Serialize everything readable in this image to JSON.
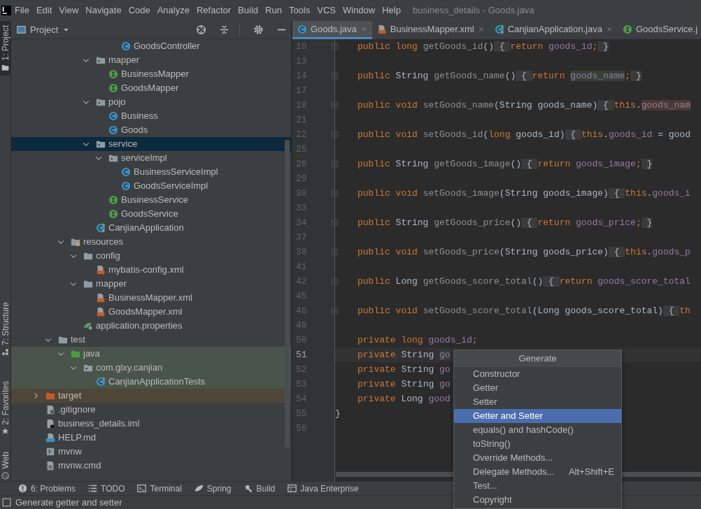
{
  "menu": {
    "items": [
      "File",
      "Edit",
      "View",
      "Navigate",
      "Code",
      "Analyze",
      "Refactor",
      "Build",
      "Run",
      "Tools",
      "VCS",
      "Window",
      "Help"
    ],
    "title": "business_details - Goods.java"
  },
  "tool_stripe": [
    {
      "label": "1: Project",
      "kind": "folder",
      "selected": true
    },
    {
      "label": "7: Structure",
      "kind": "structure",
      "selected": false
    },
    {
      "label": "2: Favorites",
      "kind": "star",
      "selected": false
    },
    {
      "label": "Web",
      "kind": "globe",
      "selected": false
    }
  ],
  "project_panel": {
    "title": "Project",
    "tree": [
      {
        "children": [
          {
            "children": [
              {
                "children": [
                  {
                    "children": [
                      {
                        "children": [
                          {
                            "children": [
                              {
                                "label": "GoodsController",
                                "kind": "class",
                                "selected": false
                              }
                            ]
                          }
                        ]
                      },
                      {
                        "label": "mapper",
                        "kind": "package",
                        "expanded": true,
                        "selected": false,
                        "children": [
                          {
                            "label": "BusinessMapper",
                            "kind": "interface",
                            "selected": false
                          },
                          {
                            "label": "GoodsMapper",
                            "kind": "interface",
                            "selected": false
                          }
                        ]
                      },
                      {
                        "label": "pojo",
                        "kind": "package",
                        "expanded": true,
                        "selected": false,
                        "children": [
                          {
                            "label": "Business",
                            "kind": "class",
                            "selected": false
                          },
                          {
                            "label": "Goods",
                            "kind": "class",
                            "selected": false
                          }
                        ]
                      },
                      {
                        "label": "service",
                        "kind": "package",
                        "expanded": true,
                        "selected": true,
                        "children": [
                          {
                            "label": "serviceImpl",
                            "kind": "package",
                            "expanded": true,
                            "selected": false,
                            "children": [
                              {
                                "label": "BusinessServiceImpl",
                                "kind": "class",
                                "selected": false
                              },
                              {
                                "label": "GoodsServiceImpl",
                                "kind": "class",
                                "selected": false
                              }
                            ]
                          },
                          {
                            "label": "BusinessService",
                            "kind": "interface",
                            "selected": false
                          },
                          {
                            "label": "GoodsService",
                            "kind": "interface",
                            "selected": false
                          }
                        ]
                      },
                      {
                        "label": "CanjianApplication",
                        "kind": "app",
                        "selected": false
                      }
                    ]
                  }
                ]
              },
              {
                "label": "resources",
                "kind": "resources",
                "expanded": true,
                "selected": false,
                "children": [
                  {
                    "label": "config",
                    "kind": "folder",
                    "expanded": true,
                    "selected": false,
                    "children": [
                      {
                        "label": "mybatis-config.xml",
                        "kind": "xml",
                        "selected": false
                      }
                    ]
                  },
                  {
                    "label": "mapper",
                    "kind": "folder",
                    "expanded": true,
                    "selected": false,
                    "children": [
                      {
                        "label": "BusinessMapper.xml",
                        "kind": "xml",
                        "selected": false
                      },
                      {
                        "label": "GoodsMapper.xml",
                        "kind": "xml",
                        "selected": false
                      }
                    ]
                  },
                  {
                    "label": "application.properties",
                    "kind": "properties",
                    "selected": false
                  }
                ]
              }
            ]
          },
          {
            "label": "test",
            "kind": "folder",
            "expanded": true,
            "selected": false,
            "children": [
              {
                "label": "java",
                "kind": "test-root",
                "expanded": true,
                "selected": false,
                "children": [
                  {
                    "label": "com.glxy.canjian",
                    "kind": "package",
                    "expanded": true,
                    "selected": false,
                    "children": [
                      {
                        "label": "CanjianApplicationTests",
                        "kind": "test-class",
                        "selected": false
                      }
                    ]
                  }
                ]
              }
            ]
          }
        ]
      },
      {
        "label": "target",
        "kind": "excluded",
        "expanded": false,
        "selected": false
      },
      {
        "label": ".gitignore",
        "kind": "gitignore",
        "selected": false
      },
      {
        "label": "business_details.iml",
        "kind": "iml",
        "selected": false
      },
      {
        "label": "HELP.md",
        "kind": "md",
        "selected": false
      },
      {
        "label": "mvnw",
        "kind": "shell",
        "selected": false
      },
      {
        "label": "mvnw.cmd",
        "kind": "cmd",
        "selected": false
      }
    ]
  },
  "editor": {
    "tabs": [
      {
        "label": "Goods.java",
        "kind": "class",
        "selected": true,
        "closable": true
      },
      {
        "label": "BusinessMapper.xml",
        "kind": "xml",
        "selected": false,
        "closable": true
      },
      {
        "label": "CanjianApplication.java",
        "kind": "app",
        "selected": false,
        "closable": true
      },
      {
        "label": "GoodsService.j",
        "kind": "interface",
        "selected": false,
        "closable": false
      }
    ],
    "lines": [
      {
        "number": "10",
        "folded": true,
        "current": false,
        "indented": true,
        "tokens": [
          {
            "text": "public long ",
            "kind": "keyword"
          },
          {
            "text": "getGoods_id",
            "kind": "method"
          },
          {
            "text": "()",
            "kind": "plain"
          },
          {
            "text": " { ",
            "kind": "fold"
          },
          {
            "text": "return ",
            "kind": "keyword"
          },
          {
            "text": "goods_id",
            "kind": "field"
          },
          {
            "text": ";",
            "kind": "keyword"
          },
          {
            "text": " }",
            "kind": "fold"
          }
        ]
      },
      {
        "number": "13",
        "folded": false,
        "current": false
      },
      {
        "number": "14",
        "folded": true,
        "current": false,
        "indented": true,
        "tokens": [
          {
            "text": "public ",
            "kind": "keyword"
          },
          {
            "text": "String ",
            "kind": "plain"
          },
          {
            "text": "getGoods_name",
            "kind": "method"
          },
          {
            "text": "()",
            "kind": "plain"
          },
          {
            "text": " { ",
            "kind": "fold"
          },
          {
            "text": "return ",
            "kind": "keyword"
          },
          {
            "text": "goods_name",
            "kind": "field-match"
          },
          {
            "text": ";",
            "kind": "keyword"
          },
          {
            "text": " }",
            "kind": "fold"
          }
        ]
      },
      {
        "number": "17",
        "folded": false,
        "current": false
      },
      {
        "number": "18",
        "folded": true,
        "current": false,
        "indented": true,
        "tokens": [
          {
            "text": "public void ",
            "kind": "keyword"
          },
          {
            "text": "setGoods_name",
            "kind": "method"
          },
          {
            "text": "(String goods_name)",
            "kind": "plain"
          },
          {
            "text": " { ",
            "kind": "fold"
          },
          {
            "text": "this",
            "kind": "keyword"
          },
          {
            "text": ".",
            "kind": "plain"
          },
          {
            "text": "goods_nam",
            "kind": "field-write"
          }
        ]
      },
      {
        "number": "21",
        "folded": false,
        "current": false
      },
      {
        "number": "22",
        "folded": true,
        "current": false,
        "indented": true,
        "tokens": [
          {
            "text": "public void ",
            "kind": "keyword"
          },
          {
            "text": "setGoods_id",
            "kind": "method"
          },
          {
            "text": "(",
            "kind": "plain"
          },
          {
            "text": "long",
            "kind": "keyword"
          },
          {
            "text": " goods_id)",
            "kind": "plain"
          },
          {
            "text": " { ",
            "kind": "fold"
          },
          {
            "text": "this",
            "kind": "keyword"
          },
          {
            "text": ".",
            "kind": "plain"
          },
          {
            "text": "goods_id",
            "kind": "field"
          },
          {
            "text": " = good",
            "kind": "plain"
          }
        ]
      },
      {
        "number": "25",
        "folded": false,
        "current": false
      },
      {
        "number": "26",
        "folded": true,
        "current": false,
        "indented": true,
        "tokens": [
          {
            "text": "public ",
            "kind": "keyword"
          },
          {
            "text": "String ",
            "kind": "plain"
          },
          {
            "text": "getGoods_image",
            "kind": "method"
          },
          {
            "text": "()",
            "kind": "plain"
          },
          {
            "text": " { ",
            "kind": "fold"
          },
          {
            "text": "return ",
            "kind": "keyword"
          },
          {
            "text": "goods_image",
            "kind": "field"
          },
          {
            "text": ";",
            "kind": "keyword"
          },
          {
            "text": " }",
            "kind": "fold"
          }
        ]
      },
      {
        "number": "29",
        "folded": false,
        "current": false
      },
      {
        "number": "30",
        "folded": true,
        "current": false,
        "indented": true,
        "tokens": [
          {
            "text": "public void ",
            "kind": "keyword"
          },
          {
            "text": "setGoods_image",
            "kind": "method"
          },
          {
            "text": "(String goods_image)",
            "kind": "plain"
          },
          {
            "text": " { ",
            "kind": "fold"
          },
          {
            "text": "this",
            "kind": "keyword"
          },
          {
            "text": ".",
            "kind": "plain"
          },
          {
            "text": "goods_i",
            "kind": "field"
          }
        ]
      },
      {
        "number": "33",
        "folded": false,
        "current": false
      },
      {
        "number": "34",
        "folded": true,
        "current": false,
        "indented": true,
        "tokens": [
          {
            "text": "public ",
            "kind": "keyword"
          },
          {
            "text": "String ",
            "kind": "plain"
          },
          {
            "text": "getGoods_price",
            "kind": "method"
          },
          {
            "text": "()",
            "kind": "plain"
          },
          {
            "text": " { ",
            "kind": "fold"
          },
          {
            "text": "return ",
            "kind": "keyword"
          },
          {
            "text": "goods_price",
            "kind": "field"
          },
          {
            "text": ";",
            "kind": "keyword"
          },
          {
            "text": " }",
            "kind": "fold"
          }
        ]
      },
      {
        "number": "37",
        "folded": false,
        "current": false
      },
      {
        "number": "38",
        "folded": true,
        "current": false,
        "indented": true,
        "tokens": [
          {
            "text": "public void ",
            "kind": "keyword"
          },
          {
            "text": "setGoods_price",
            "kind": "method"
          },
          {
            "text": "(String goods_price)",
            "kind": "plain"
          },
          {
            "text": " { ",
            "kind": "fold"
          },
          {
            "text": "this",
            "kind": "keyword"
          },
          {
            "text": ".",
            "kind": "plain"
          },
          {
            "text": "goods_p",
            "kind": "field"
          }
        ]
      },
      {
        "number": "41",
        "folded": false,
        "current": false
      },
      {
        "number": "42",
        "folded": true,
        "current": false,
        "indented": true,
        "tokens": [
          {
            "text": "public ",
            "kind": "keyword"
          },
          {
            "text": "Long ",
            "kind": "plain"
          },
          {
            "text": "getGoods_score_total",
            "kind": "method"
          },
          {
            "text": "()",
            "kind": "plain"
          },
          {
            "text": " { ",
            "kind": "fold"
          },
          {
            "text": "return ",
            "kind": "keyword"
          },
          {
            "text": "goods_score_total",
            "kind": "field"
          }
        ]
      },
      {
        "number": "45",
        "folded": false,
        "current": false
      },
      {
        "number": "46",
        "folded": true,
        "current": false,
        "indented": true,
        "tokens": [
          {
            "text": "public void ",
            "kind": "keyword"
          },
          {
            "text": "setGoods_score_total",
            "kind": "method"
          },
          {
            "text": "(Long goods_score_total)",
            "kind": "plain"
          },
          {
            "text": " { ",
            "kind": "fold"
          },
          {
            "text": "th",
            "kind": "keyword"
          }
        ]
      },
      {
        "number": "49",
        "folded": false,
        "current": false
      },
      {
        "number": "50",
        "folded": false,
        "current": false,
        "indented": true,
        "tokens": [
          {
            "text": "private long ",
            "kind": "keyword"
          },
          {
            "text": "goods_id",
            "kind": "field"
          },
          {
            "text": ";",
            "kind": "keyword"
          }
        ]
      },
      {
        "number": "51",
        "folded": false,
        "current": true,
        "indented": true,
        "tokens": [
          {
            "text": "private ",
            "kind": "keyword"
          },
          {
            "text": "String ",
            "kind": "plain"
          },
          {
            "text": "go",
            "kind": "field-match"
          }
        ]
      },
      {
        "number": "52",
        "folded": false,
        "current": false,
        "indented": true,
        "tokens": [
          {
            "text": "private ",
            "kind": "keyword"
          },
          {
            "text": "String ",
            "kind": "plain"
          },
          {
            "text": "go",
            "kind": "field"
          }
        ]
      },
      {
        "number": "53",
        "folded": false,
        "current": false,
        "indented": true,
        "tokens": [
          {
            "text": "private ",
            "kind": "keyword"
          },
          {
            "text": "String ",
            "kind": "plain"
          },
          {
            "text": "go",
            "kind": "field"
          }
        ]
      },
      {
        "number": "54",
        "folded": false,
        "current": false,
        "indented": true,
        "tokens": [
          {
            "text": "private ",
            "kind": "keyword"
          },
          {
            "text": "Long ",
            "kind": "plain"
          },
          {
            "text": "good",
            "kind": "field"
          }
        ]
      },
      {
        "number": "55",
        "folded": false,
        "current": false,
        "indented": false,
        "tokens": [
          {
            "text": "}",
            "kind": "plain"
          }
        ]
      },
      {
        "number": "56",
        "folded": false,
        "current": false
      }
    ]
  },
  "generate_popup": {
    "title": "Generate",
    "items": [
      {
        "label": "Constructor",
        "selected": false
      },
      {
        "label": "Getter",
        "selected": false
      },
      {
        "label": "Setter",
        "selected": false
      },
      {
        "label": "Getter and Setter",
        "selected": true
      },
      {
        "label": "equals() and hashCode()",
        "selected": false
      },
      {
        "label": "toString()",
        "selected": false
      },
      {
        "label": "Override Methods...",
        "selected": false
      },
      {
        "label": "Delegate Methods...",
        "shortcut": "Alt+Shift+E",
        "selected": false
      },
      {
        "label": "Test...",
        "selected": false
      },
      {
        "label": "Copyright",
        "selected": false
      }
    ]
  },
  "tool_windows": [
    {
      "label": "6: Problems",
      "kind": "problems"
    },
    {
      "label": "TODO",
      "kind": "todo"
    },
    {
      "label": "Terminal",
      "kind": "terminal"
    },
    {
      "label": "Spring",
      "kind": "spring"
    },
    {
      "label": "Build",
      "kind": "build"
    },
    {
      "label": "Java Enterprise",
      "kind": "enterprise"
    }
  ],
  "status_bar": {
    "message": "Generate getter and setter"
  }
}
